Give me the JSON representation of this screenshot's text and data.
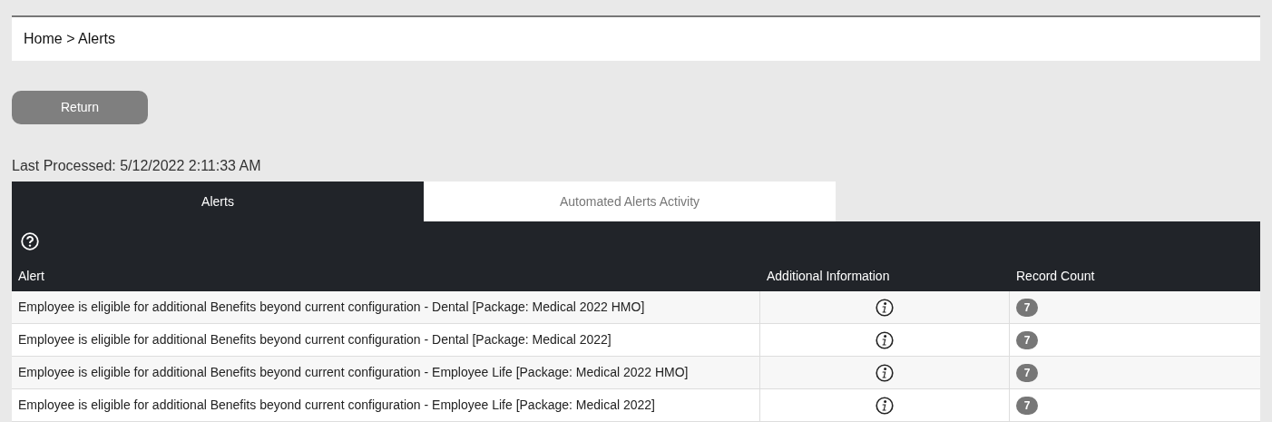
{
  "breadcrumb": "Home > Alerts",
  "return_button": "Return",
  "last_processed": "Last Processed: 5/12/2022 2:11:33 AM",
  "tabs": [
    {
      "label": "Alerts",
      "selected": true
    },
    {
      "label": "Automated Alerts Activity",
      "selected": false
    }
  ],
  "table": {
    "columns": [
      "Alert",
      "Additional Information",
      "Record Count"
    ],
    "rows": [
      {
        "alert": "Employee is eligible for additional Benefits beyond current configuration - Dental [Package: Medical 2022 HMO]",
        "record_count": "7"
      },
      {
        "alert": "Employee is eligible for additional Benefits beyond current configuration - Dental [Package: Medical 2022]",
        "record_count": "7"
      },
      {
        "alert": "Employee is eligible for additional Benefits beyond current configuration - Employee Life [Package: Medical 2022 HMO]",
        "record_count": "7"
      },
      {
        "alert": "Employee is eligible for additional Benefits beyond current configuration - Employee Life [Package: Medical 2022]",
        "record_count": "7"
      }
    ]
  }
}
